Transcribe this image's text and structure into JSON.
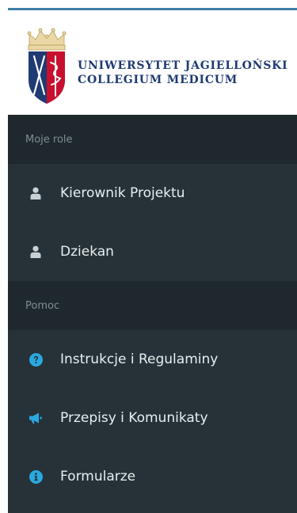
{
  "logo": {
    "line1": "UNIWERSYTET JAGIELLOŃSKI",
    "line2": "COLLEGIUM MEDICUM"
  },
  "colors": {
    "accent_bar": "#3d7fa6",
    "sidebar_bg": "#263238",
    "section_bg": "#1f282d",
    "section_text": "#7f8c92",
    "item_text": "#e8eef0",
    "icon_user": "#c9d1d4",
    "icon_help": "#29a9e0",
    "brand_blue": "#1f3b73",
    "brand_red": "#c8102e"
  },
  "sidebar": {
    "sections": [
      {
        "header": "Moje role",
        "items": [
          {
            "label": "Kierownik Projektu",
            "icon": "user-icon"
          },
          {
            "label": "Dziekan",
            "icon": "user-icon"
          }
        ]
      },
      {
        "header": "Pomoc",
        "items": [
          {
            "label": "Instrukcje i Regulaminy",
            "icon": "question-circle-icon"
          },
          {
            "label": "Przepisy i Komunikaty",
            "icon": "bullhorn-icon"
          },
          {
            "label": "Formularze",
            "icon": "info-circle-icon"
          }
        ]
      }
    ]
  }
}
